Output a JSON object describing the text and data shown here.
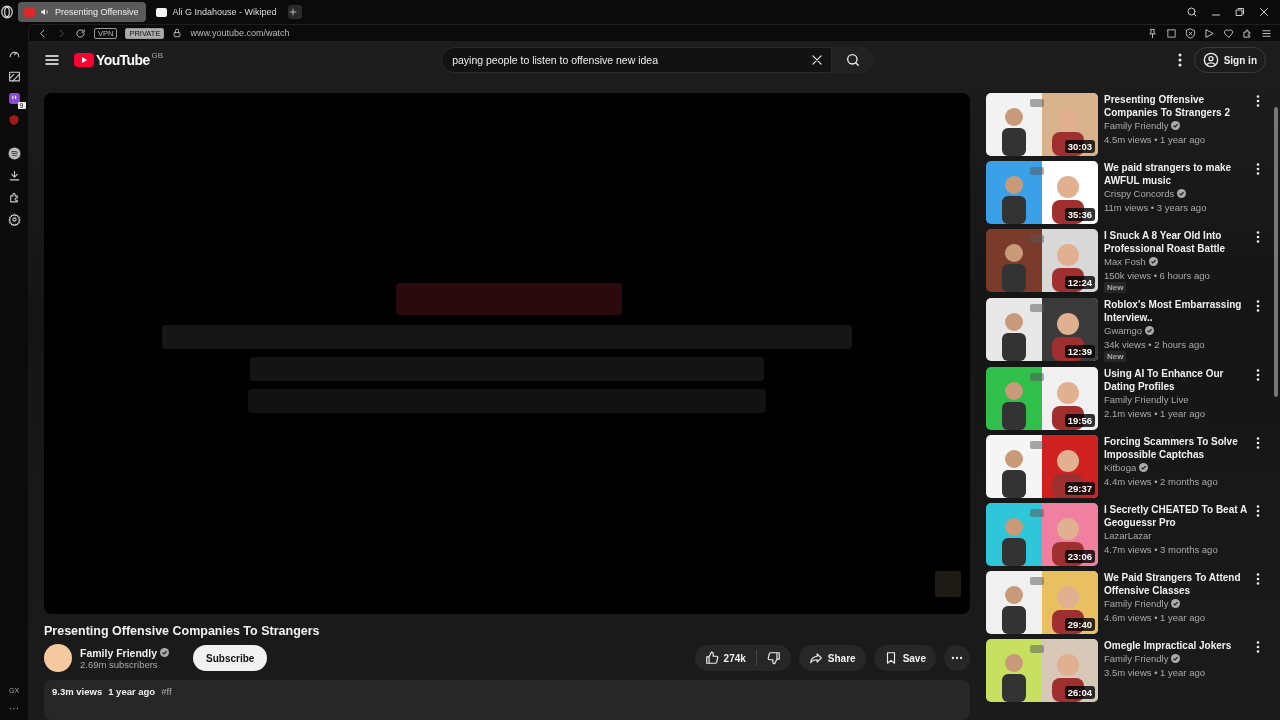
{
  "browser_tabs": [
    {
      "title": "Presenting Offensive",
      "selected": true,
      "audio": true
    },
    {
      "title": "Ali G Indahouse - Wikiped",
      "selected": false,
      "audio": false
    }
  ],
  "sidebar": {
    "notification_count": "9",
    "gx_label": "GX",
    "more": "···"
  },
  "address_bar": {
    "vpn": "VPN",
    "private": "PRIVATE",
    "url": "www.youtube.com/watch"
  },
  "header": {
    "logo": "YouTube",
    "region": "GB",
    "search": {
      "value": "paying people to listen to offensive new idea"
    },
    "sign_in": "Sign in"
  },
  "video": {
    "title": "Presenting Offensive Companies To Strangers",
    "channel": "Family Friendly",
    "verified": true,
    "subscribers": "2.69m subscribers",
    "subscribe": "Subscribe",
    "likes": "274k",
    "share": "Share",
    "save": "Save",
    "views": "9.3m views",
    "age": "1 year ago",
    "tag": "#ff"
  },
  "recommendations": [
    {
      "title": "Presenting Offensive Companies To Strangers 2",
      "channel": "Family Friendly",
      "verified": true,
      "meta": "4.5m views • 1 year ago",
      "duration": "30:03"
    },
    {
      "title": "We paid strangers to make AWFUL music",
      "channel": "Crispy Concords",
      "verified": true,
      "meta": "11m views • 3 years ago",
      "duration": "35:36"
    },
    {
      "title": "I Snuck A 8 Year Old Into Professional Roast Battle",
      "channel": "Max Fosh",
      "verified": true,
      "meta": "150k views • 6 hours ago",
      "duration": "12:24",
      "badge": "New"
    },
    {
      "title": "Roblox's Most Embarrassing Interview..",
      "channel": "Gwamgo",
      "verified": true,
      "meta": "34k views • 2 hours ago",
      "duration": "12:39",
      "badge": "New"
    },
    {
      "title": "Using AI To Enhance Our Dating Profiles",
      "channel": "Family Friendly Live",
      "verified": false,
      "meta": "2.1m views • 1 year ago",
      "duration": "19:56"
    },
    {
      "title": "Forcing Scammers To Solve Impossible Captchas",
      "channel": "Kitboga",
      "verified": true,
      "meta": "4.4m views • 2 months ago",
      "duration": "29:37"
    },
    {
      "title": "I Secretly CHEATED To Beat A Geoguessr Pro",
      "channel": "LazarLazar",
      "verified": false,
      "meta": "4.7m views • 3 months ago",
      "duration": "23:06"
    },
    {
      "title": "We Paid Strangers To Attend Offensive Classes",
      "channel": "Family Friendly",
      "verified": true,
      "meta": "4.6m views • 1 year ago",
      "duration": "29:40"
    },
    {
      "title": "Omegle Impractical Jokers",
      "channel": "Family Friendly",
      "verified": true,
      "meta": "3.5m views • 1 year ago",
      "duration": "26:04"
    }
  ]
}
